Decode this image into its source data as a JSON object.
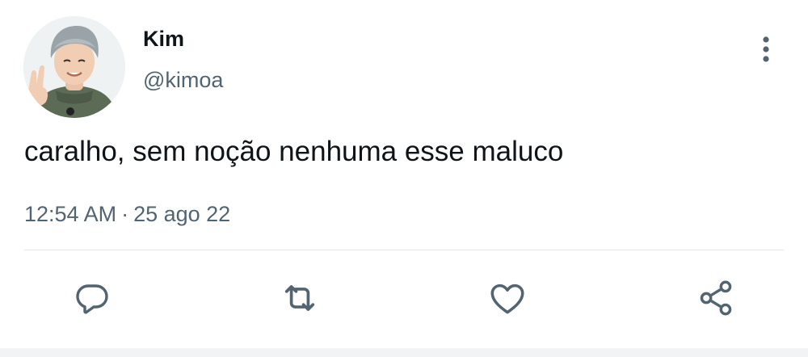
{
  "tweet": {
    "display_name": "Kim",
    "handle": "@kimoa",
    "text": "caralho, sem noção nenhuma esse maluco",
    "time": "12:54 AM",
    "separator": "·",
    "date": "25 ago 22"
  },
  "icons": {
    "more": "more-vertical-icon",
    "reply": "reply-icon",
    "retweet": "retweet-icon",
    "like": "heart-icon",
    "share": "share-icon"
  },
  "colors": {
    "text_primary": "#0f1419",
    "text_secondary": "#536471",
    "divider": "#e1e8ed"
  }
}
